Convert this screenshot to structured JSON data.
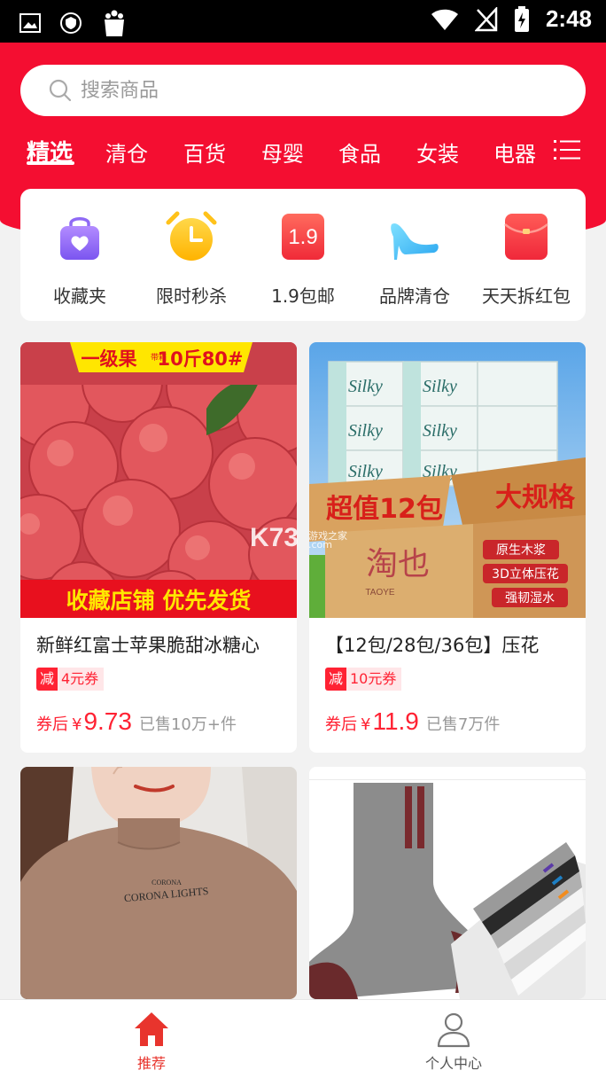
{
  "status_bar": {
    "time": "2:48"
  },
  "search": {
    "placeholder": "搜索商品"
  },
  "tabs": [
    {
      "label": "精选",
      "active": true
    },
    {
      "label": "清仓"
    },
    {
      "label": "百货"
    },
    {
      "label": "母婴"
    },
    {
      "label": "食品"
    },
    {
      "label": "女装"
    },
    {
      "label": "电器"
    }
  ],
  "categories": [
    {
      "label": "收藏夹",
      "icon": "favorites-bag-icon"
    },
    {
      "label": "限时秒杀",
      "icon": "alarm-clock-icon"
    },
    {
      "label": "1.9包邮",
      "icon": "price-tag-icon",
      "badge": "1.9"
    },
    {
      "label": "品牌清仓",
      "icon": "high-heel-icon"
    },
    {
      "label": "天天拆红包",
      "icon": "red-envelope-icon"
    }
  ],
  "products": [
    {
      "title": "新鲜红富士苹果脆甜冰糖心",
      "coupon_prefix": "减",
      "coupon": "4元券",
      "price_label": "券后",
      "currency": "¥",
      "price": "9.73",
      "sold": "已售10万+件",
      "image": {
        "banner_top": "一级果",
        "banner_top_small": "带箱",
        "banner_top_right": "10斤80#",
        "banner_bottom": "收藏店铺 优先发货"
      }
    },
    {
      "title": "【12包/28包/36包】压花",
      "coupon_prefix": "减",
      "coupon": "10元券",
      "price_label": "券后",
      "currency": "¥",
      "price": "11.9",
      "sold": "已售7万件",
      "image": {
        "brand": "Silky",
        "left_text": "超值12包",
        "right_text": "大规格",
        "box_text": "淘也",
        "box_subtext": "TAOYE",
        "features": [
          "原生木浆",
          "3D立体压花",
          "强韧湿水"
        ]
      }
    },
    {
      "image": {
        "shirt_text_1": "CORONA",
        "shirt_text_2": "CORONA LIGHTS"
      }
    },
    {
      "image": {}
    }
  ],
  "watermark": {
    "text": "K73",
    "sub": "游戏之家",
    "domain": ".com"
  },
  "bottom_nav": [
    {
      "label": "推荐",
      "icon": "home-icon",
      "active": true
    },
    {
      "label": "个人中心",
      "icon": "user-icon"
    }
  ],
  "colors": {
    "brand_red": "#f40e31",
    "price_red": "#ff2233",
    "nav_active": "#e8342d"
  }
}
